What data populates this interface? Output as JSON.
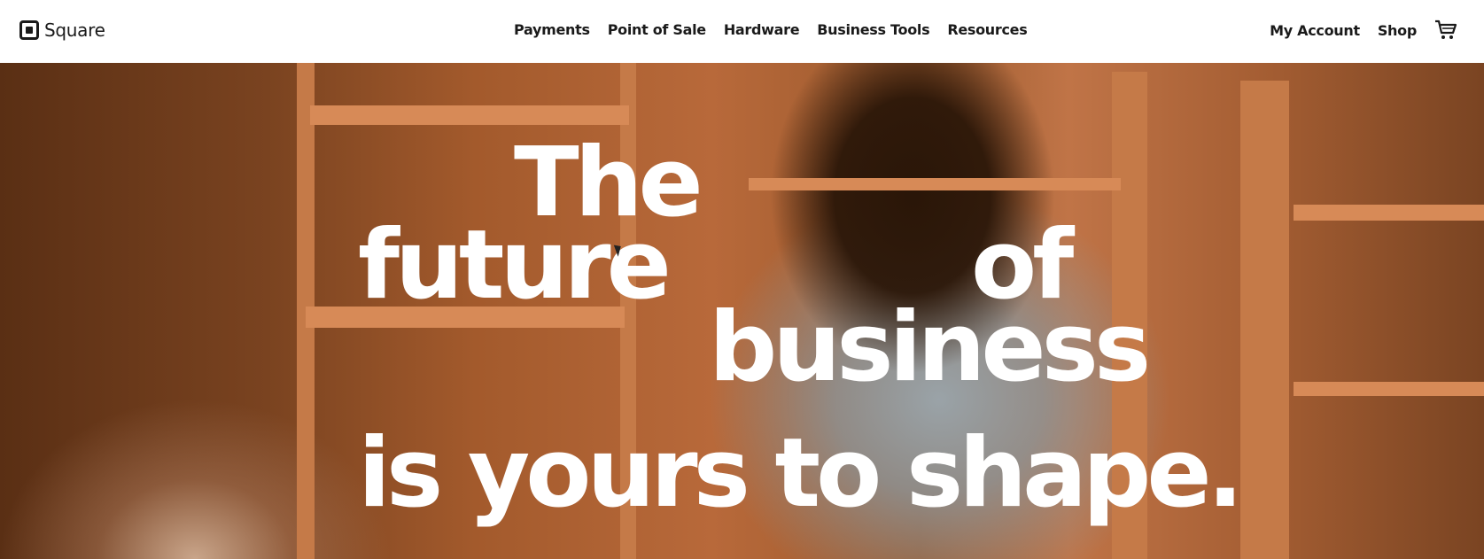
{
  "brand": {
    "name": "Square",
    "logo_icon": "square-logo-icon"
  },
  "nav": {
    "items": [
      {
        "label": "Payments"
      },
      {
        "label": "Point of Sale"
      },
      {
        "label": "Hardware"
      },
      {
        "label": "Business Tools"
      },
      {
        "label": "Resources"
      }
    ],
    "account_label": "My Account",
    "shop_label": "Shop",
    "cart_icon": "cart-icon"
  },
  "hero": {
    "headline_words": [
      "The",
      "future",
      "of",
      "business",
      "is yours to shape."
    ],
    "background": "photo of smiling woman placing a wooden bowl on warm-toned shelves"
  },
  "colors": {
    "text": "#1a1a1a",
    "headline": "#ffffff",
    "hero_tone": "#b8693a"
  }
}
